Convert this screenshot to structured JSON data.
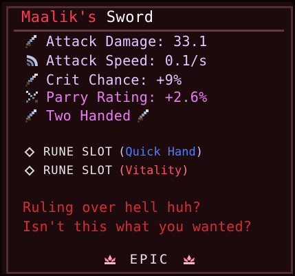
{
  "tooltip": {
    "title": {
      "owner": "Maalik's",
      "item": "Sword"
    },
    "stats": [
      {
        "icon": "sword-icon",
        "text": "Attack Damage: 33.1",
        "color": "#dcc8ff"
      },
      {
        "icon": "swoosh-icon",
        "text": "Attack Speed: 0.1/s",
        "color": "#dcc8ff"
      },
      {
        "icon": "dagger-icon",
        "text": "Crit Chance: +9%",
        "color": "#dcc8ff"
      },
      {
        "icon": "crossed-swords-icon",
        "text": "Parry Rating: +2.6%",
        "color": "#e67df2"
      },
      {
        "icon": "sword-icon",
        "text": "Two Handed",
        "color": "#e67df2"
      }
    ],
    "runes": [
      {
        "label": "RUNE SLOT",
        "open": "(",
        "value": "Quick Hand",
        "close": ")",
        "value_color": "#4f7dff"
      },
      {
        "label": "RUNE SLOT",
        "open": "(",
        "value": "Vitality",
        "close": ")",
        "value_color": "#ff4f5f"
      }
    ],
    "lore": [
      "Ruling over hell huh?",
      "Isn't this what you wanted?"
    ],
    "rarity": "EPIC",
    "colors": {
      "background": "#1d0a0d",
      "border": "#5a2a33",
      "owner": "#ff3b4e",
      "lore": "#d62c34"
    }
  }
}
